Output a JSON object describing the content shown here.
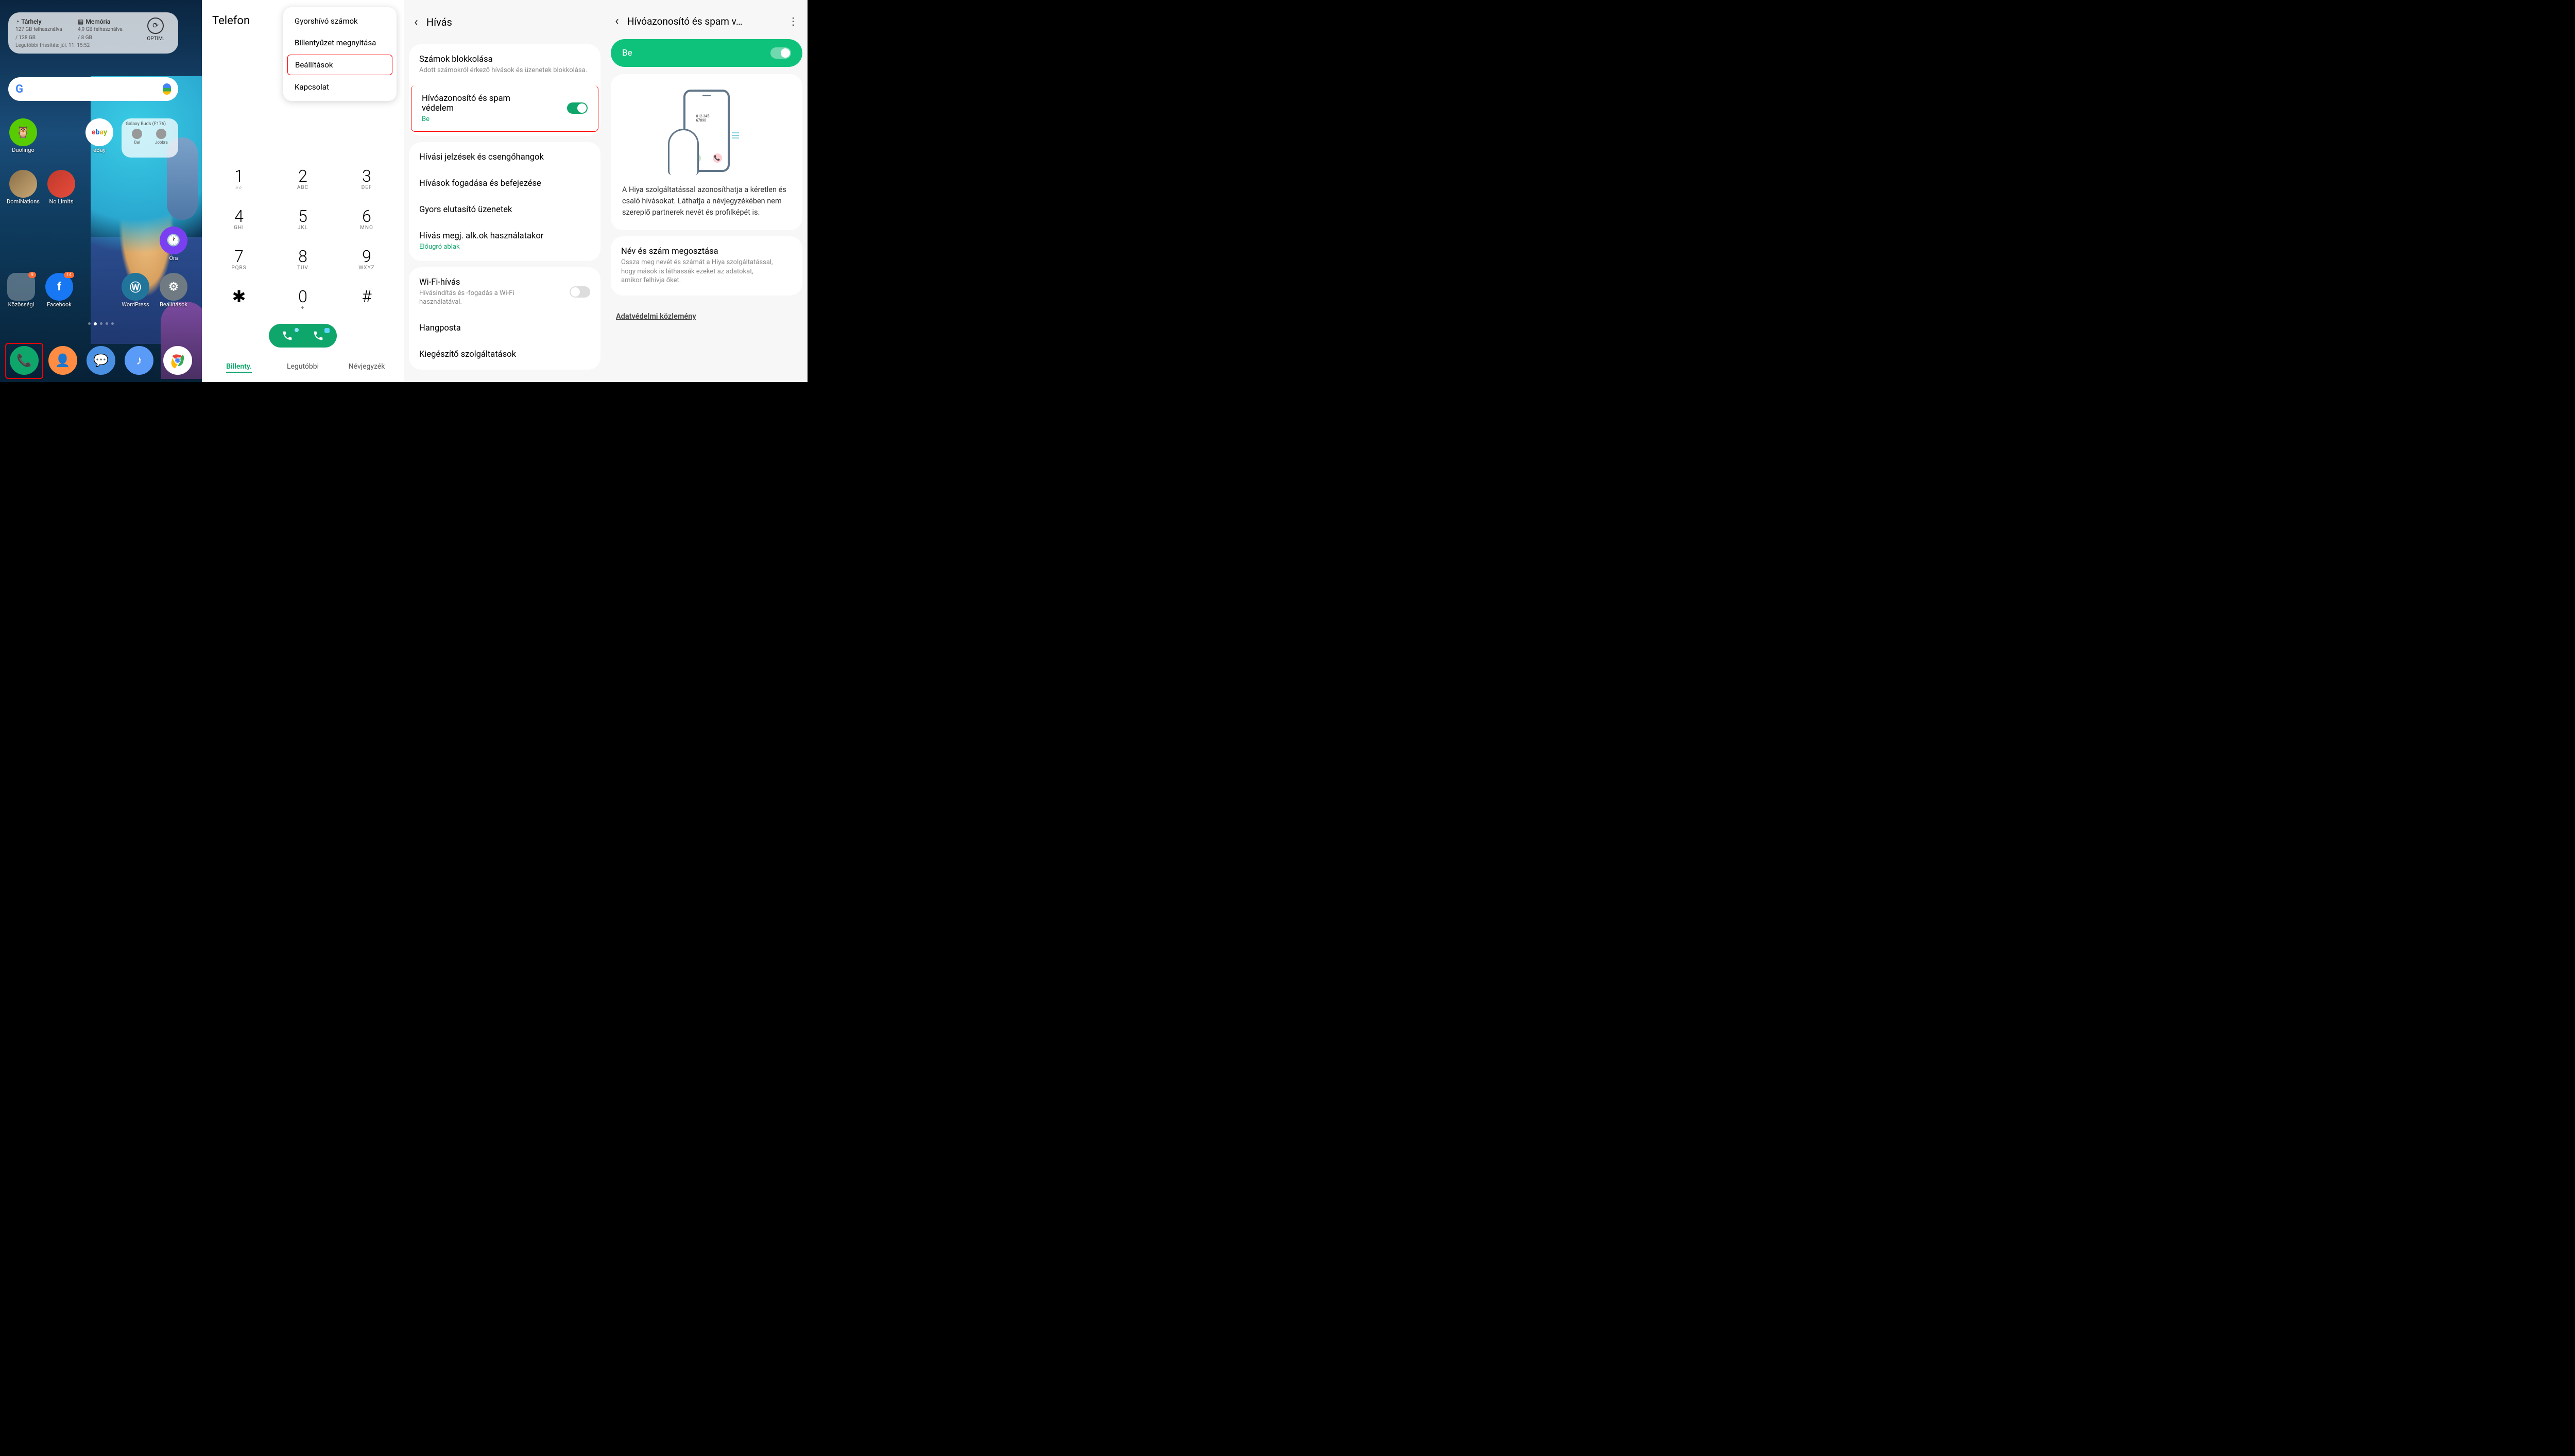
{
  "home": {
    "storage_widget": {
      "storage_label": "Tárhely",
      "storage_used": "127 GB felhasználva",
      "storage_total": "/ 128 GB",
      "memory_label": "Memória",
      "memory_used": "4,9 GB felhasználva",
      "memory_total": "/ 8 GB",
      "optim_label": "OPTIM.",
      "last_update": "Legutóbbi frissítés: júl. 11. 15:52"
    },
    "buds_widget": {
      "title": "Galaxy Buds (F176)",
      "left": "Bal",
      "right": "Jobbra"
    },
    "apps": {
      "duolingo": "Duolingo",
      "ebay": "eBay",
      "dominations": "DomiNations",
      "nolimits": "No Limits",
      "clock": "Óra",
      "community": "Közösségi",
      "facebook": "Facebook",
      "wordpress": "WordPress",
      "settings": "Beállítások"
    },
    "badges": {
      "community": "9",
      "facebook": "14"
    }
  },
  "dialer": {
    "title": "Telefon",
    "popup": [
      "Gyorshívó számok",
      "Billentyűzet megnyitása",
      "Beállítások",
      "Kapcsolat"
    ],
    "keys": [
      {
        "d": "1",
        "l": "ᵒᵒ"
      },
      {
        "d": "2",
        "l": "ABC"
      },
      {
        "d": "3",
        "l": "DEF"
      },
      {
        "d": "4",
        "l": "GHI"
      },
      {
        "d": "5",
        "l": "JKL"
      },
      {
        "d": "6",
        "l": "MNO"
      },
      {
        "d": "7",
        "l": "PQRS"
      },
      {
        "d": "8",
        "l": "TUV"
      },
      {
        "d": "9",
        "l": "WXYZ"
      },
      {
        "d": "✱",
        "l": ""
      },
      {
        "d": "0",
        "l": "+"
      },
      {
        "d": "#",
        "l": ""
      }
    ],
    "tabs": [
      "Billenty.",
      "Legutóbbi",
      "Névjegyzék"
    ]
  },
  "callSettings": {
    "title": "Hívás",
    "items": {
      "block_numbers_t": "Számok blokkolása",
      "block_numbers_s": "Adott számokról érkező hívások és üzenetek blokkolása.",
      "callerid_t": "Hívóazonosító és spam védelem",
      "callerid_stat": "Be",
      "alerts_t": "Hívási jelzések és csengőhangok",
      "answer_t": "Hívások fogadása és befejezése",
      "quick_t": "Gyors elutasító üzenetek",
      "callbg_t": "Hívás megj. alk.ok használatakor",
      "callbg_stat": "Előugró ablak",
      "wifi_t": "Wi-Fi-hívás",
      "wifi_s": "Hívásindítás és -fogadás a Wi-Fi használatával.",
      "voicemail_t": "Hangposta",
      "extra_t": "Kiegészítő szolgáltatások"
    }
  },
  "callerId": {
    "title": "Hívóazonosító és spam v…",
    "toggle_label": "Be",
    "illus_number": "012-345-67890",
    "description": "A Hiya szolgáltatással azonosíthatja a kéretlen és csaló hívásokat. Láthatja a névjegyzékében nem szereplő partnerek nevét és profilképét is.",
    "share_t": "Név és szám megosztása",
    "share_s": "Ossza meg nevét és számát a Hiya szolgáltatással, hogy mások is láthassák ezeket az adatokat, amikor felhívja őket.",
    "privacy_link": "Adatvédelmi közlemény"
  }
}
